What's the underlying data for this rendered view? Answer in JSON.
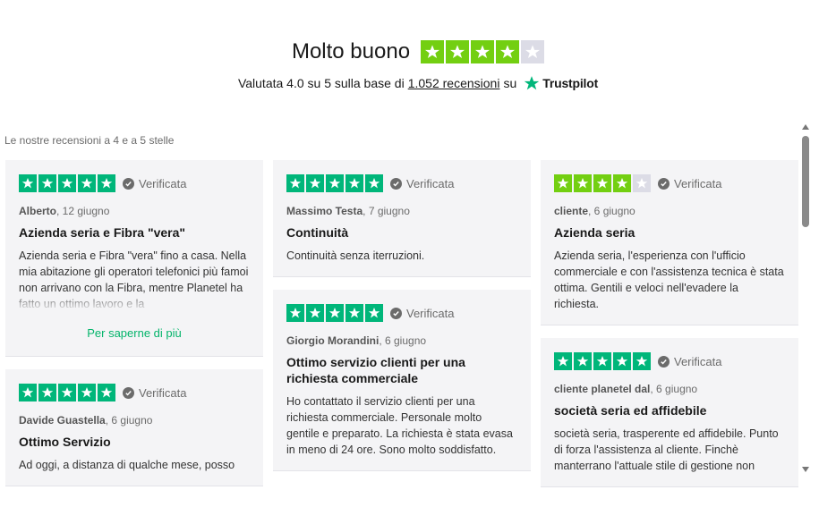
{
  "header": {
    "title": "Molto buono",
    "rating_stars": 4,
    "subtitle_before": "Valutata 4.0 su 5 sulla base di",
    "reviews_link": "1.052 recensioni",
    "subtitle_after": "su",
    "brand": "Trustpilot"
  },
  "colors": {
    "star_green": "#00b67a",
    "star_lime": "#73cf11",
    "star_empty": "#dcdce6",
    "link_green": "#04b46b"
  },
  "section_label": "Le nostre recensioni a 4 e a 5 stelle",
  "reviews": [
    {
      "rating": 5,
      "verified": "Verificata",
      "author": "Alberto",
      "date": ", 12 giugno",
      "title": "Azienda seria e Fibra \"vera\"",
      "body": "Azienda seria e Fibra \"vera\" fino a casa. Nella mia abitazione gli operatori telefonici più famoi non arrivano con la Fibra, mentre Planetel ha fatto un ottimo lavoro e la",
      "more": "Per saperne di più"
    },
    {
      "rating": 5,
      "verified": "Verificata",
      "author": "Davide Guastella",
      "date": ", 6 giugno",
      "title": "Ottimo Servizio",
      "body": "Ad oggi, a distanza di qualche mese, posso"
    },
    {
      "rating": 5,
      "verified": "Verificata",
      "author": "Massimo Testa",
      "date": ", 7 giugno",
      "title": "Continuità",
      "body": "Continuità senza iterruzioni."
    },
    {
      "rating": 5,
      "verified": "Verificata",
      "author": "Giorgio Morandini",
      "date": ", 6 giugno",
      "title": "Ottimo servizio clienti per una richiesta commerciale",
      "body": "Ho contattato il servizio clienti per una richiesta commerciale. Personale molto gentile e preparato. La richiesta è stata evasa in meno di 24 ore. Sono molto soddisfatto."
    },
    {
      "rating": 4,
      "verified": "Verificata",
      "author": "cliente",
      "date": ", 6 giugno",
      "title": "Azienda seria",
      "body": "Azienda seria, l'esperienza con l'ufficio commerciale e con l'assistenza tecnica è stata ottima. Gentili e veloci nell'evadere la richiesta."
    },
    {
      "rating": 5,
      "verified": "Verificata",
      "author": "cliente planetel dal",
      "date": ", 6 giugno",
      "title": "società seria ed affidebile",
      "body": "società seria, trasperente ed affidebile. Punto di forza l'assistenza al cliente. Finchè manterrano l'attuale stile di gestione non"
    }
  ]
}
